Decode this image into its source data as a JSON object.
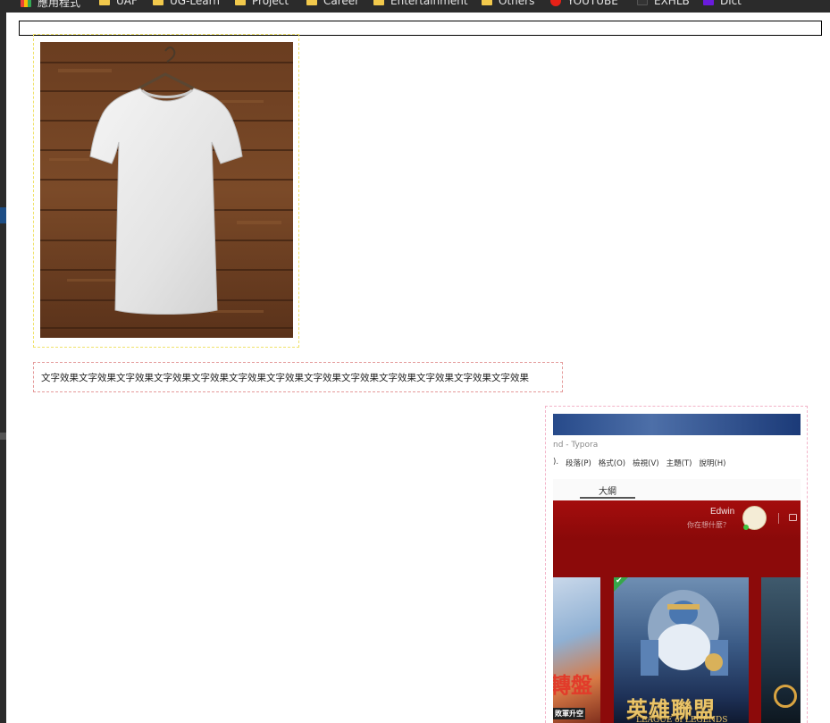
{
  "bookmarks_bar": {
    "items": [
      {
        "label": "應用程式",
        "icon": "apps-grid-icon"
      },
      {
        "label": "UAF",
        "icon": "folder-icon"
      },
      {
        "label": "UG-Learn",
        "icon": "folder-icon"
      },
      {
        "label": "Project",
        "icon": "folder-icon"
      },
      {
        "label": "Career",
        "icon": "folder-icon"
      },
      {
        "label": "Entertainment",
        "icon": "folder-icon"
      },
      {
        "label": "Others",
        "icon": "folder-icon"
      },
      {
        "label": "YOUTUBE",
        "icon": "youtube-icon"
      },
      {
        "label": "EXHLB",
        "icon": "extension-icon"
      },
      {
        "label": "Dict",
        "icon": "dictionary-icon"
      }
    ]
  },
  "text_box": {
    "text": "文字效果文字效果文字效果文字效果文字效果文字效果文字效果文字效果文字效果文字效果文字效果文字效果文字效果"
  },
  "screenshot": {
    "app_title": "nd - Typora",
    "menu_items": [
      ").",
      "段落(P)",
      "格式(O)",
      "檢視(V)",
      "主題(T)",
      "說明(H)"
    ],
    "outline_tab": "大綱",
    "username": "Edwin",
    "status": "你在想什麼？",
    "promo_text_big": "轉盤",
    "promo_text_small": "敗軍升空",
    "lol_title": "英雄聯盟",
    "lol_subtitle": "LEAGUE of LEGENDS"
  },
  "colors": {
    "tee_card_border": "#f0e26a",
    "text_box_border": "#e49a9a",
    "shot_card_border": "#f2b3c8",
    "client_red": "#8c0a0a"
  }
}
